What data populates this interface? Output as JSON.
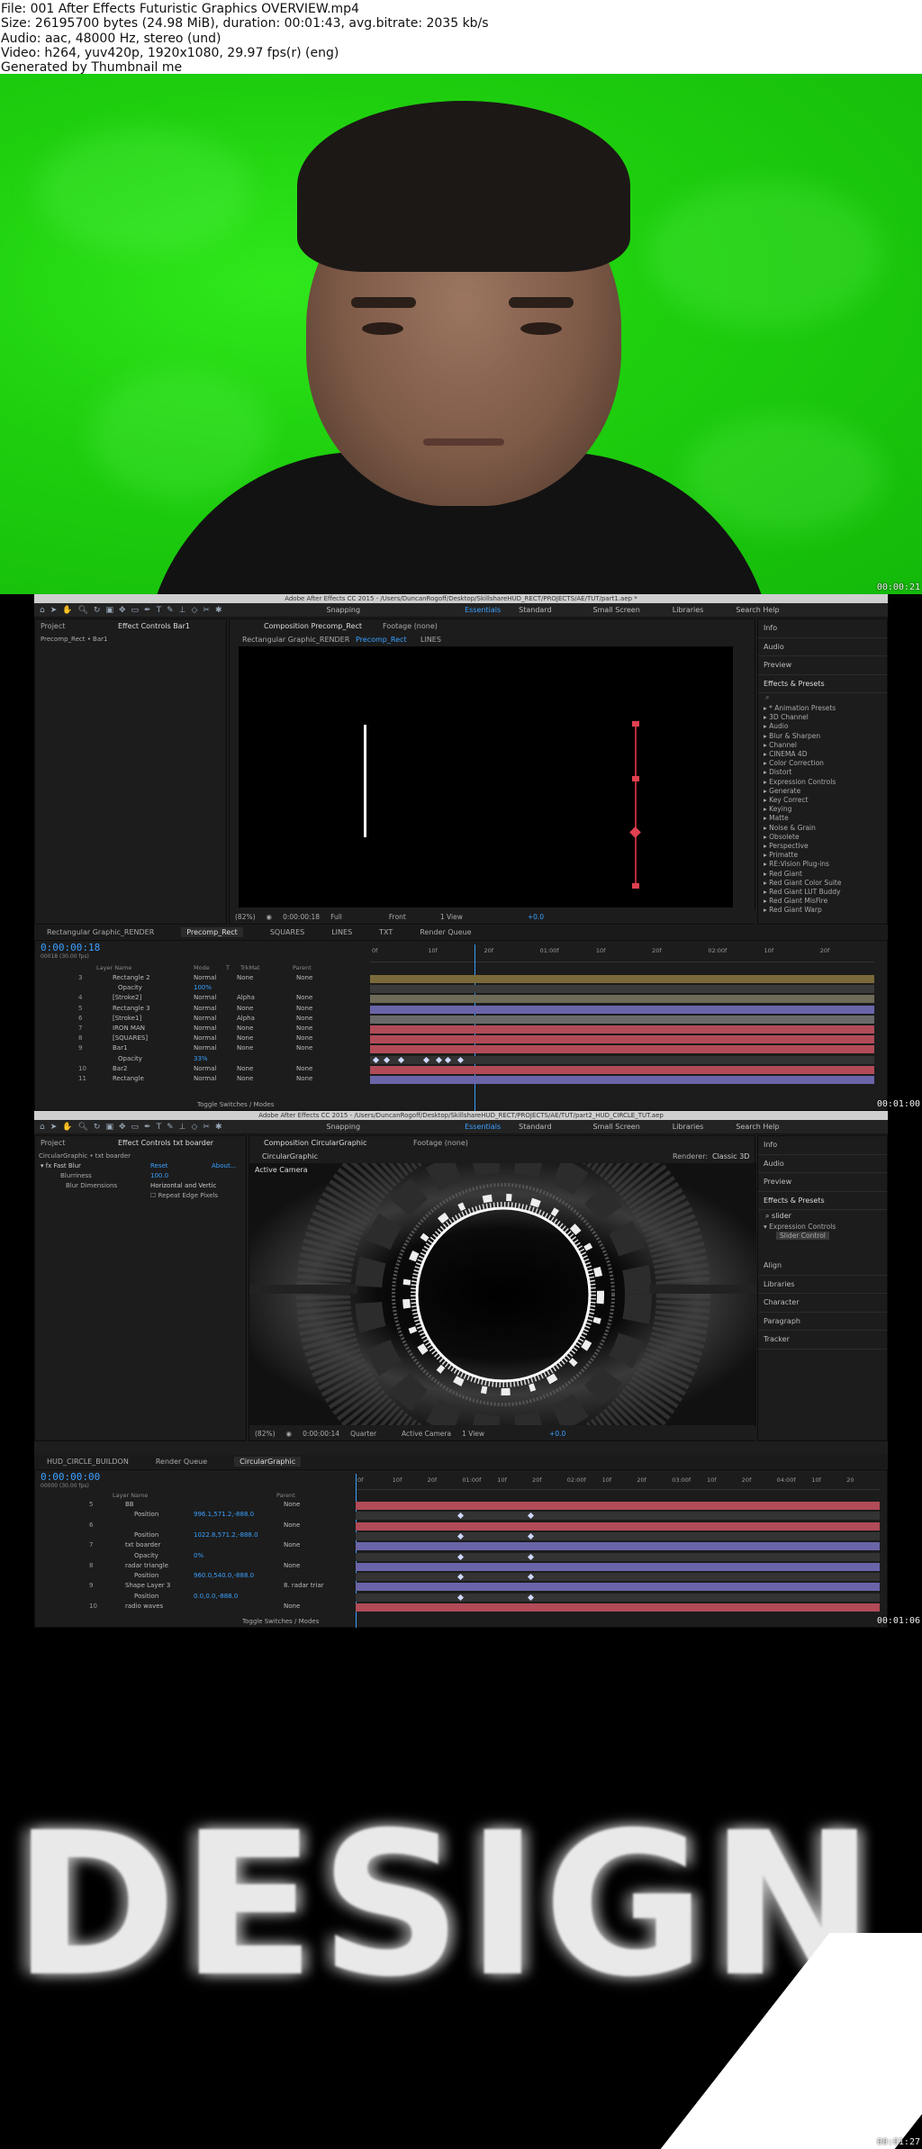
{
  "header": {
    "file": "File: 001 After Effects Futuristic Graphics OVERVIEW.mp4",
    "size": "Size: 26195700 bytes (24.98 MiB), duration: 00:01:43, avg.bitrate: 2035 kb/s",
    "audio": "Audio: aac, 48000 Hz, stereo (und)",
    "video": "Video: h264, yuv420p, 1920x1080, 29.97 fps(r) (eng)",
    "generated": "Generated by Thumbnail me"
  },
  "frames": [
    {
      "timestamp": "00:00:21"
    },
    {
      "timestamp": "00:01:00"
    },
    {
      "timestamp": "00:01:06"
    },
    {
      "timestamp": "00:01:27"
    }
  ],
  "ae1": {
    "title": "Adobe After Effects CC 2015 - /Users/DuncanRogoff/Desktop/SkillshareHUD_RECT/PROJECTS/AE/TUT/part1.aep *",
    "snapping": "Snapping",
    "workspaces": [
      "Essentials",
      "Standard",
      "Small Screen",
      "Libraries"
    ],
    "search_help": "Search Help",
    "left_tabs": [
      "Project",
      "Effect Controls Bar1"
    ],
    "left_sub": "Precomp_Rect • Bar1",
    "comp_tab": "Composition Precomp_Rect",
    "footage_tab": "Footage (none)",
    "breadcrumbs": [
      "Rectangular Graphic_RENDER",
      "Precomp_Rect",
      "LINES"
    ],
    "right_sections": [
      "Info",
      "Audio",
      "Preview"
    ],
    "effects_title": "Effects & Presets",
    "effects": [
      "* Animation Presets",
      "3D Channel",
      "Audio",
      "Blur & Sharpen",
      "Channel",
      "CINEMA 4D",
      "Color Correction",
      "Distort",
      "Expression Controls",
      "Generate",
      "Key Correct",
      "Keying",
      "Matte",
      "Noise & Grain",
      "Obsolete",
      "Perspective",
      "Primatte",
      "RE:Vision Plug-ins",
      "Red Giant",
      "Red Giant Color Suite",
      "Red Giant LUT Buddy",
      "Red Giant MisFire",
      "Red Giant Warp"
    ],
    "viewer_bar": [
      "(82%)",
      "0:00:00:18",
      "Full",
      "Front",
      "1 View",
      "+0.0"
    ],
    "timeline_tabs": [
      "Rectangular Graphic_RENDER",
      "Precomp_Rect",
      "SQUARES",
      "LINES",
      "TXT",
      "Render Queue"
    ],
    "timecode": "0:00:00:18",
    "fps": "00018 (30.00 fps)",
    "col_headers": [
      "Layer Name",
      "Mode",
      "T",
      "TrkMat",
      "Parent"
    ],
    "layers": [
      {
        "n": "3",
        "name": "Rectangle 2",
        "mode": "Normal",
        "trk": "None",
        "parent": "None",
        "color": "#7a6a3a"
      },
      {
        "n": "",
        "name": "Opacity",
        "value": "100%",
        "color": "#3b3b3b"
      },
      {
        "n": "4",
        "name": "[Stroke2]",
        "mode": "Normal",
        "trk": "Alpha",
        "parent": "None",
        "color": "#6e6a58"
      },
      {
        "n": "5",
        "name": "Rectangle 3",
        "mode": "Normal",
        "trk": "None",
        "parent": "None",
        "color": "#6a65a8"
      },
      {
        "n": "6",
        "name": "[Stroke1]",
        "mode": "Normal",
        "trk": "Alpha",
        "parent": "None",
        "color": "#6a6a6a"
      },
      {
        "n": "7",
        "name": "IRON MAN",
        "mode": "Normal",
        "trk": "None",
        "parent": "None",
        "color": "#b14b58"
      },
      {
        "n": "8",
        "name": "[SQUARES]",
        "mode": "Normal",
        "trk": "None",
        "parent": "None",
        "color": "#b14b58"
      },
      {
        "n": "9",
        "name": "Bar1",
        "mode": "Normal",
        "trk": "None",
        "parent": "None",
        "color": "#b14b58"
      },
      {
        "n": "",
        "name": "Opacity",
        "value": "33%",
        "color": "#333"
      },
      {
        "n": "10",
        "name": "Bar2",
        "mode": "Normal",
        "trk": "None",
        "parent": "None",
        "color": "#b14b58"
      },
      {
        "n": "11",
        "name": "Rectangle",
        "mode": "Normal",
        "trk": "None",
        "parent": "None",
        "color": "#6a65a8"
      }
    ],
    "ruler": [
      "0f",
      "10f",
      "20f",
      "01:00f",
      "10f",
      "20f",
      "02:00f",
      "10f",
      "20f"
    ],
    "toggle": "Toggle Switches / Modes"
  },
  "ae2": {
    "title": "Adobe After Effects CC 2015 - /Users/DuncanRogoff/Desktop/SkillshareHUD_RECT/PROJECTS/AE/TUT/part2_HUD_CIRCLE_TUT.aep",
    "snapping": "Snapping",
    "workspaces": [
      "Essentials",
      "Standard",
      "Small Screen",
      "Libraries"
    ],
    "search_help": "Search Help",
    "left_tabs": [
      "Project",
      "Effect Controls txt boarder"
    ],
    "left_sub": "CircularGraphic • txt boarder",
    "fx_name": "Fast Blur",
    "fx_reset": "Reset",
    "fx_about": "About...",
    "fx_rows": [
      {
        "label": "Blurriness",
        "value": "100.0"
      },
      {
        "label": "Blur Dimensions",
        "value": "Horizontal and Vertic"
      },
      {
        "label": "",
        "value": "Repeat Edge Pixels"
      }
    ],
    "comp_tab": "Composition CircularGraphic",
    "footage_tab": "Footage (none)",
    "breadcrumb": "CircularGraphic",
    "renderer": "Renderer:",
    "renderer_value": "Classic 3D",
    "active_camera": "Active Camera",
    "right_sections_top": [
      "Info",
      "Audio",
      "Preview"
    ],
    "effects_title": "Effects & Presets",
    "search_value": "slider",
    "tree": [
      "Expression Controls",
      "Slider Control"
    ],
    "right_sections_bottom": [
      "Align",
      "Libraries",
      "Character",
      "Paragraph",
      "Tracker"
    ],
    "viewer_bar": [
      "(82%)",
      "0:00:00:14",
      "Quarter",
      "Active Camera",
      "1 View",
      "+0.0"
    ],
    "timeline_tabs": [
      "HUD_CIRCLE_BUILDON",
      "Render Queue",
      "CircularGraphic"
    ],
    "timecode": "0:00:00:00",
    "fps": "00000 (30.00 fps)",
    "col_headers": [
      "Layer Name",
      "Parent"
    ],
    "layers": [
      {
        "n": "5",
        "name": "BB",
        "parent": "None",
        "color": "#b14b58"
      },
      {
        "n": "",
        "name": "Position",
        "value": "996.1,571.2,-888.0",
        "color": "#333"
      },
      {
        "n": "6",
        "name": "",
        "parent": "None",
        "color": "#b14b58"
      },
      {
        "n": "",
        "name": "Position",
        "value": "1022.8,571.2,-888.0",
        "color": "#333"
      },
      {
        "n": "7",
        "name": "txt boarder",
        "parent": "None",
        "color": "#6a65a8"
      },
      {
        "n": "",
        "name": "Opacity",
        "value": "0%",
        "color": "#333"
      },
      {
        "n": "8",
        "name": "radar triangle",
        "parent": "None",
        "color": "#6a65a8"
      },
      {
        "n": "",
        "name": "Position",
        "value": "960.0,540.0,-888.0",
        "color": "#333"
      },
      {
        "n": "9",
        "name": "Shape Layer 3",
        "parent": "8. radar triar",
        "color": "#6a65a8"
      },
      {
        "n": "",
        "name": "Position",
        "value": "0.0,0.0,-888.0",
        "color": "#333"
      },
      {
        "n": "10",
        "name": "radio waves",
        "parent": "None",
        "color": "#b14b58"
      }
    ],
    "ruler": [
      "0f",
      "10f",
      "20f",
      "01:00f",
      "10f",
      "20f",
      "02:00f",
      "10f",
      "20f",
      "03:00f",
      "10f",
      "20f",
      "04:00f",
      "10f",
      "20"
    ],
    "toggle": "Toggle Switches / Modes"
  },
  "design": {
    "word": "DESIGN"
  }
}
